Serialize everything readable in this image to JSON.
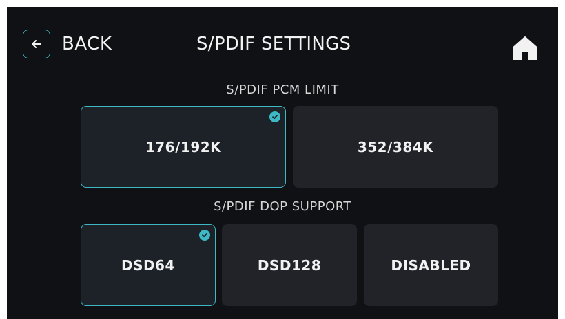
{
  "header": {
    "back_label": "BACK",
    "title": "S/PDIF SETTINGS",
    "back_icon": "arrow-left-icon",
    "home_icon": "home-icon"
  },
  "pcm_limit": {
    "label": "S/PDIF PCM LIMIT",
    "options": [
      {
        "label": "176/192K",
        "selected": true
      },
      {
        "label": "352/384K",
        "selected": false
      }
    ]
  },
  "dop_support": {
    "label": "S/PDIF DOP SUPPORT",
    "options": [
      {
        "label": "DSD64",
        "selected": true
      },
      {
        "label": "DSD128",
        "selected": false
      },
      {
        "label": "DISABLED",
        "selected": false
      }
    ]
  },
  "colors": {
    "background": "#0f1114",
    "tile": "#212329",
    "accent": "#3db8c4",
    "text": "#f2f2f2"
  }
}
